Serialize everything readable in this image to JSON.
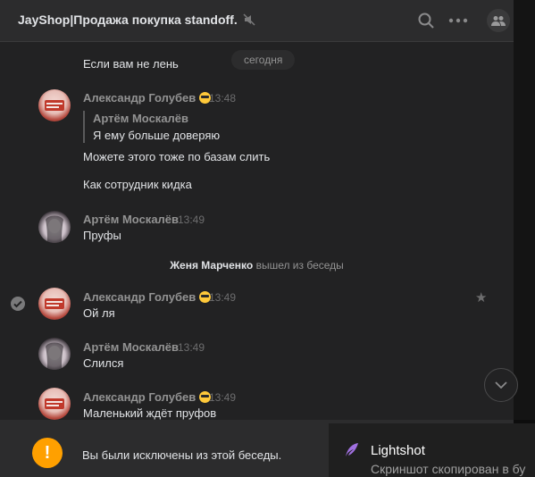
{
  "header": {
    "title": "JayShop|Продажа покупка standoff.",
    "icons": [
      "mute-icon",
      "search-icon",
      "more-icon",
      "members-icon"
    ]
  },
  "messages": {
    "date_separator": "сегодня",
    "prev_text": "Если вам не лень",
    "group1": {
      "author": "Александр Голубев",
      "time": "13:48",
      "quote_author": "Артём Москалёв",
      "quote_text": "Я ему больше доверяю",
      "text1": "Можете этого тоже по базам слить",
      "text2": "Как сотрудник кидка"
    },
    "group2": {
      "author": "Артём Москалёв",
      "time": "13:49",
      "text": "Пруфы"
    },
    "service": {
      "name": "Женя Марченко",
      "action": "вышел из беседы"
    },
    "group3": {
      "author": "Александр Голубев",
      "time": "13:49",
      "text": "Ой ля"
    },
    "group4": {
      "author": "Артём Москалёв",
      "time": "13:49",
      "text": "Слился"
    },
    "group5": {
      "author": "Александр Голубев",
      "time": "13:49",
      "text": "Маленький ждёт пруфов"
    }
  },
  "footer": {
    "notice": "Вы были исключены из этой беседы."
  },
  "toast": {
    "title": "Lightshot",
    "subtitle": "Скриншот скопирован в бу"
  },
  "colors": {
    "accent_warning": "#ffa000",
    "background": "#222223",
    "muted_text": "#939393"
  }
}
